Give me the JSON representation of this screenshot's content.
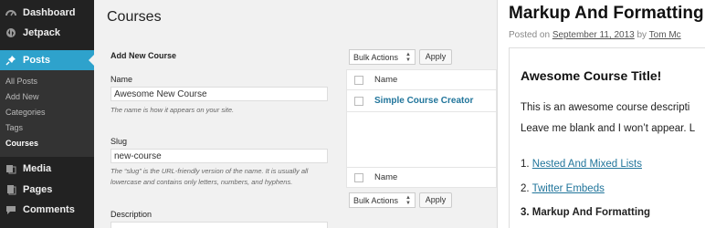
{
  "sidebar": {
    "items": [
      {
        "label": "Dashboard",
        "icon": "dashboard-icon"
      },
      {
        "label": "Jetpack",
        "icon": "jetpack-icon"
      },
      {
        "label": "Posts",
        "icon": "pin-icon",
        "active": true
      },
      {
        "label": "Media",
        "icon": "media-icon"
      },
      {
        "label": "Pages",
        "icon": "pages-icon"
      },
      {
        "label": "Comments",
        "icon": "comments-icon"
      }
    ],
    "submenu": [
      "All Posts",
      "Add New",
      "Categories",
      "Tags",
      "Courses"
    ],
    "accent_color": "#2ea2cc"
  },
  "main": {
    "title": "Courses",
    "add_heading": "Add New Course",
    "name_label": "Name",
    "name_value": "Awesome New Course",
    "name_help": "The name is how it appears on your site.",
    "slug_label": "Slug",
    "slug_value": "new-course",
    "slug_help": "The “slug” is the URL-friendly version of the name. It is usually all lowercase and contains only letters, numbers, and hyphens.",
    "description_label": "Description"
  },
  "list": {
    "bulk_label": "Bulk Actions",
    "apply_label": "Apply",
    "column_name": "Name",
    "rows": [
      "Simple Course Creator"
    ]
  },
  "preview": {
    "title": "Markup And Formatting",
    "posted_on": "Posted on",
    "date": "September 11, 2013",
    "by": "by",
    "author": "Tom Mc",
    "course_title": "Awesome Course Title!",
    "line1": "This is an awesome course descripti",
    "line2": "Leave me blank and I won’t appear. L",
    "list": [
      {
        "num": "1.",
        "text": "Nested And Mixed Lists",
        "link": true
      },
      {
        "num": "2.",
        "text": "Twitter Embeds",
        "link": true
      },
      {
        "num": "3.",
        "text": "Markup And Formatting",
        "link": false
      }
    ]
  }
}
